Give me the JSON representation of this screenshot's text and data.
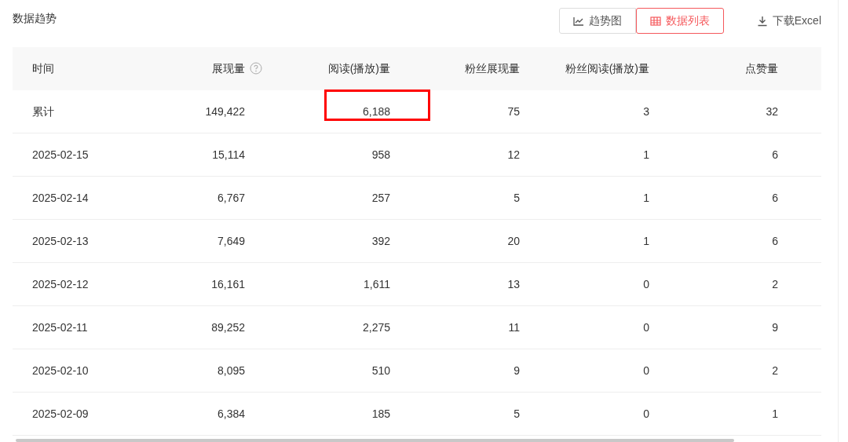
{
  "title": "数据趋势",
  "view_tabs": [
    {
      "label": "趋势图",
      "kind": "trend",
      "selected": false
    },
    {
      "label": "数据列表",
      "kind": "list",
      "selected": true
    }
  ],
  "download": {
    "label": "下载Excel"
  },
  "table": {
    "columns": [
      {
        "label": "时间",
        "help": false
      },
      {
        "label": "展现量",
        "help": true
      },
      {
        "label": "阅读(播放)量",
        "help": false
      },
      {
        "label": "粉丝展现量",
        "help": false
      },
      {
        "label": "粉丝阅读(播放)量",
        "help": false
      },
      {
        "label": "点赞量",
        "help": false
      }
    ],
    "rows": [
      {
        "date": "累计",
        "impressions": "149,422",
        "reads": "6,188",
        "fan_impressions": "75",
        "fan_reads": "3",
        "likes": "32",
        "reads_highlighted": true
      },
      {
        "date": "2025-02-15",
        "impressions": "15,114",
        "reads": "958",
        "fan_impressions": "12",
        "fan_reads": "1",
        "likes": "6",
        "reads_highlighted": false
      },
      {
        "date": "2025-02-14",
        "impressions": "6,767",
        "reads": "257",
        "fan_impressions": "5",
        "fan_reads": "1",
        "likes": "6",
        "reads_highlighted": false
      },
      {
        "date": "2025-02-13",
        "impressions": "7,649",
        "reads": "392",
        "fan_impressions": "20",
        "fan_reads": "1",
        "likes": "6",
        "reads_highlighted": false
      },
      {
        "date": "2025-02-12",
        "impressions": "16,161",
        "reads": "1,611",
        "fan_impressions": "13",
        "fan_reads": "0",
        "likes": "2",
        "reads_highlighted": false
      },
      {
        "date": "2025-02-11",
        "impressions": "89,252",
        "reads": "2,275",
        "fan_impressions": "11",
        "fan_reads": "0",
        "likes": "9",
        "reads_highlighted": false
      },
      {
        "date": "2025-02-10",
        "impressions": "8,095",
        "reads": "510",
        "fan_impressions": "9",
        "fan_reads": "0",
        "likes": "2",
        "reads_highlighted": false
      },
      {
        "date": "2025-02-09",
        "impressions": "6,384",
        "reads": "185",
        "fan_impressions": "5",
        "fan_reads": "0",
        "likes": "1",
        "reads_highlighted": false
      }
    ]
  }
}
